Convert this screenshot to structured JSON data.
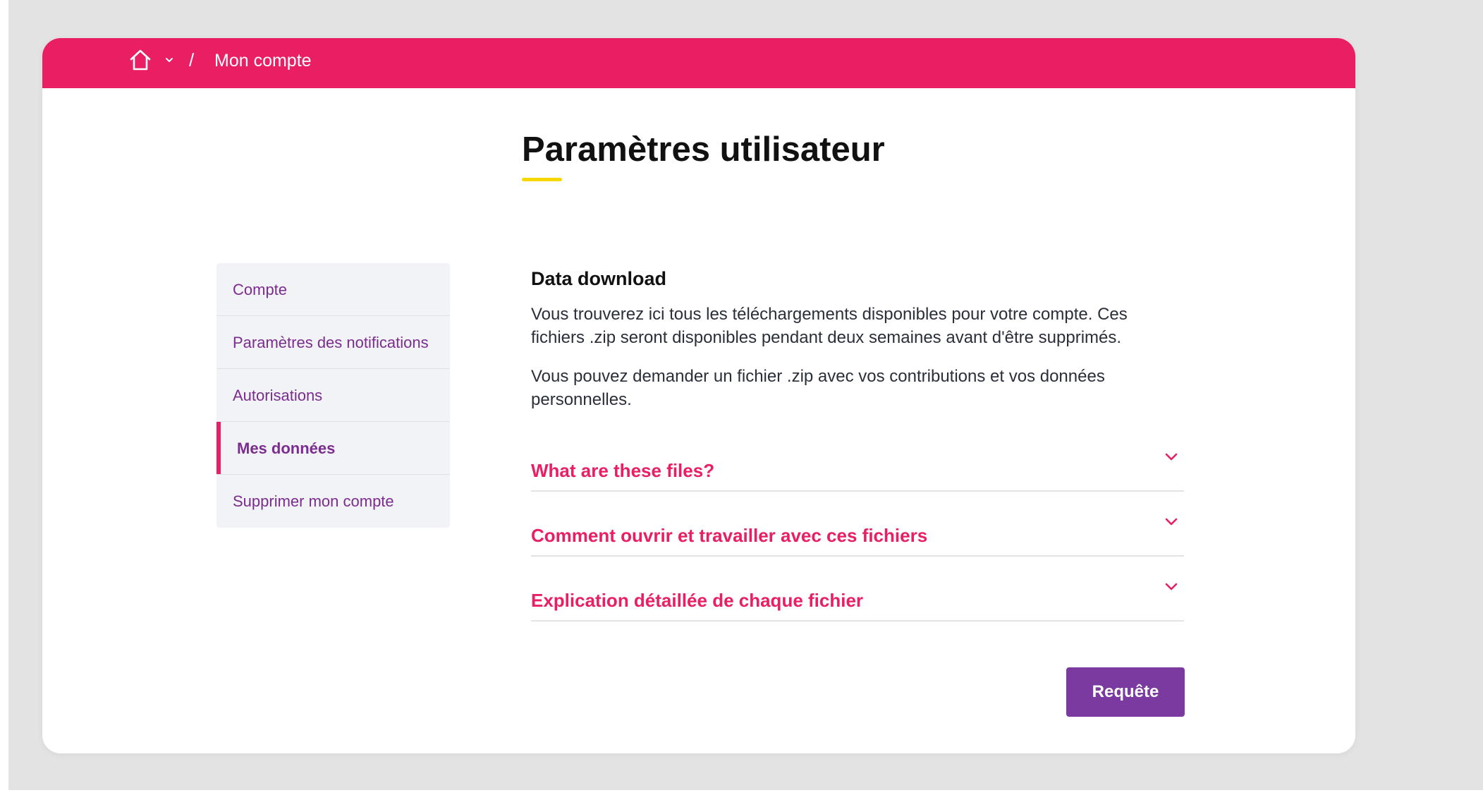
{
  "colors": {
    "brand": "#e91e63",
    "accent_purple": "#7b3aa0",
    "nav_text": "#7b2c8f",
    "title_underline": "#f6d800",
    "backdrop": "#e3e3e3"
  },
  "header": {
    "home_icon": "home-icon",
    "home_dropdown_icon": "chevron-down-icon",
    "separator": "/",
    "current": "Mon compte"
  },
  "page": {
    "title": "Paramètres utilisateur"
  },
  "sidebar": {
    "items": [
      {
        "label": "Compte",
        "active": false
      },
      {
        "label": "Paramètres des notifications",
        "active": false
      },
      {
        "label": "Autorisations",
        "active": false
      },
      {
        "label": "Mes données",
        "active": true
      },
      {
        "label": "Supprimer mon compte",
        "active": false
      }
    ]
  },
  "main": {
    "section_title": "Data download",
    "paragraph1": "Vous trouverez ici tous les téléchargements disponibles pour votre compte. Ces fichiers .zip seront disponibles pendant deux semaines avant d'être supprimés.",
    "paragraph2": "Vous pouvez demander un fichier .zip avec vos contributions et vos données personnelles.",
    "accordion": [
      {
        "label": "What are these files?",
        "icon": "chevron-down-icon"
      },
      {
        "label": "Comment ouvrir et travailler avec ces fichiers",
        "icon": "chevron-down-icon"
      },
      {
        "label": "Explication détaillée de chaque fichier",
        "icon": "chevron-down-icon"
      }
    ],
    "request_button": "Requête"
  }
}
